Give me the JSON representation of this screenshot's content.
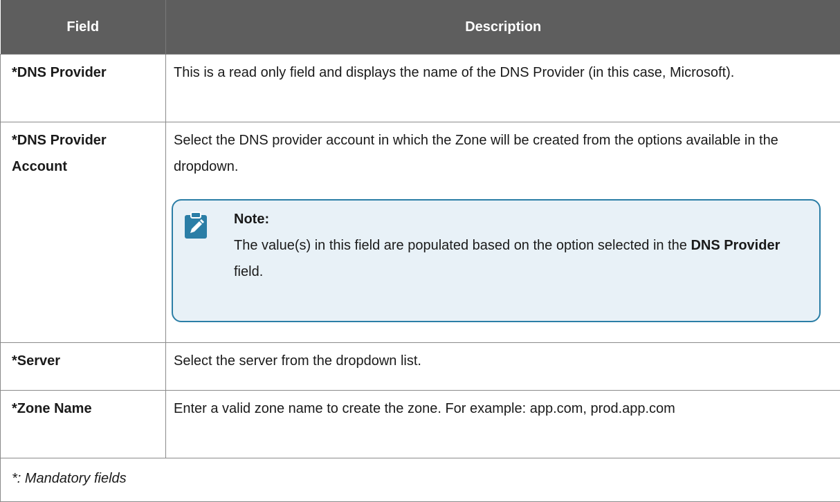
{
  "header": {
    "field_label": "Field",
    "description_label": "Description"
  },
  "rows": [
    {
      "field": "*DNS Provider",
      "description": "This is a read only field and displays the name of the DNS Provider (in this case, Microsoft)."
    },
    {
      "field": "*DNS Provider Account",
      "description": "Select the DNS provider account in which the Zone will be created from the options available in the dropdown.",
      "note": {
        "icon": "note-pencil-icon",
        "title": "Note:",
        "text_before": "The value(s) in this field are populated based on the option selected in the ",
        "bold": "DNS Provider",
        "text_after": " field.",
        "accent_color": "#2b7ea6",
        "background_color": "#e8f1f7"
      }
    },
    {
      "field": "*Server",
      "description": "Select the server from the dropdown list."
    },
    {
      "field": "*Zone Name",
      "description": "Enter a valid zone name to create the zone. For example: app.com, prod.app.com"
    }
  ],
  "footer": {
    "text": "*: Mandatory fields"
  },
  "colors": {
    "header_background": "#5e5e5e",
    "header_text": "#ffffff",
    "border": "#8a8a8a"
  }
}
